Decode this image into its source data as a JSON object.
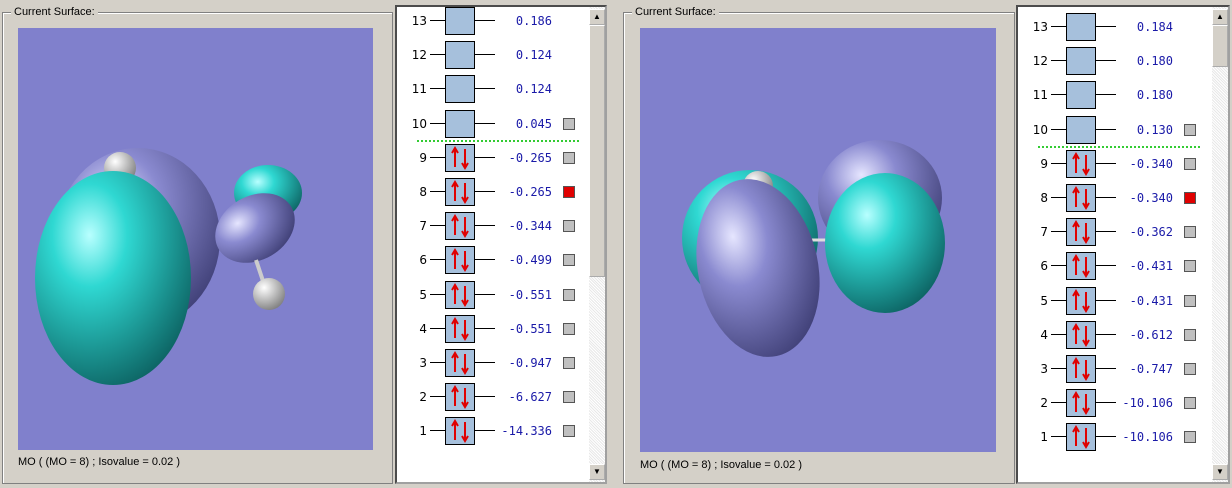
{
  "panels": [
    {
      "surface_label": "Current Surface:",
      "status": "MO ( (MO = 8) ; Isovalue = 0.02 )",
      "orbitals": [
        {
          "n": "13",
          "energy": "0.186",
          "occupied": false,
          "marker": null
        },
        {
          "n": "12",
          "energy": "0.124",
          "occupied": false,
          "marker": null
        },
        {
          "n": "11",
          "energy": "0.124",
          "occupied": false,
          "marker": null
        },
        {
          "n": "10",
          "energy": "0.045",
          "occupied": false,
          "marker": "gray"
        },
        {
          "n": "9",
          "energy": "-0.265",
          "occupied": true,
          "marker": "gray"
        },
        {
          "n": "8",
          "energy": "-0.265",
          "occupied": true,
          "marker": "red"
        },
        {
          "n": "7",
          "energy": "-0.344",
          "occupied": true,
          "marker": "gray"
        },
        {
          "n": "6",
          "energy": "-0.499",
          "occupied": true,
          "marker": "gray"
        },
        {
          "n": "5",
          "energy": "-0.551",
          "occupied": true,
          "marker": "gray"
        },
        {
          "n": "4",
          "energy": "-0.551",
          "occupied": true,
          "marker": "gray"
        },
        {
          "n": "3",
          "energy": "-0.947",
          "occupied": true,
          "marker": "gray"
        },
        {
          "n": "2",
          "energy": "-6.627",
          "occupied": true,
          "marker": "gray"
        },
        {
          "n": "1",
          "energy": "-14.336",
          "occupied": true,
          "marker": "gray"
        }
      ]
    },
    {
      "surface_label": "Current Surface:",
      "status": "MO ( (MO = 8) ; Isovalue = 0.02 )",
      "orbitals": [
        {
          "n": "13",
          "energy": "0.184",
          "occupied": false,
          "marker": null
        },
        {
          "n": "12",
          "energy": "0.180",
          "occupied": false,
          "marker": null
        },
        {
          "n": "11",
          "energy": "0.180",
          "occupied": false,
          "marker": null
        },
        {
          "n": "10",
          "energy": "0.130",
          "occupied": false,
          "marker": "gray"
        },
        {
          "n": "9",
          "energy": "-0.340",
          "occupied": true,
          "marker": "gray"
        },
        {
          "n": "8",
          "energy": "-0.340",
          "occupied": true,
          "marker": "red"
        },
        {
          "n": "7",
          "energy": "-0.362",
          "occupied": true,
          "marker": "gray"
        },
        {
          "n": "6",
          "energy": "-0.431",
          "occupied": true,
          "marker": "gray"
        },
        {
          "n": "5",
          "energy": "-0.431",
          "occupied": true,
          "marker": "gray"
        },
        {
          "n": "4",
          "energy": "-0.612",
          "occupied": true,
          "marker": "gray"
        },
        {
          "n": "3",
          "energy": "-0.747",
          "occupied": true,
          "marker": "gray"
        },
        {
          "n": "2",
          "energy": "-10.106",
          "occupied": true,
          "marker": "gray"
        },
        {
          "n": "1",
          "energy": "-10.106",
          "occupied": true,
          "marker": "gray"
        }
      ]
    }
  ],
  "colors": {
    "positive_lobe": "#33d6d0",
    "negative_lobe": "#8888cc",
    "background": "#8080cc",
    "selected": "#e00000"
  }
}
